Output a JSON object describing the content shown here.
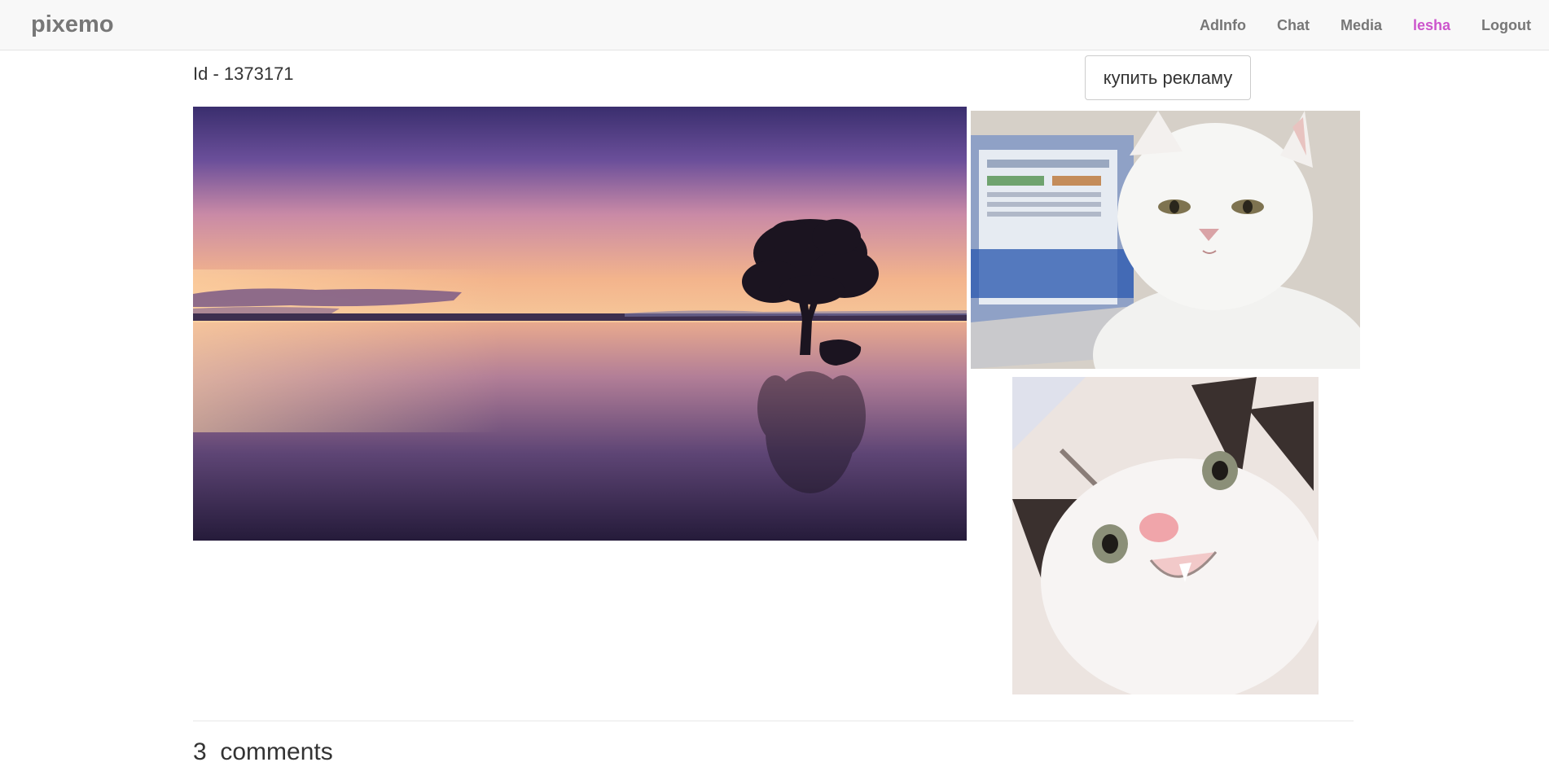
{
  "navbar": {
    "brand": "pixemo",
    "links": [
      "AdInfo",
      "Chat",
      "Media",
      "lesha",
      "Logout"
    ]
  },
  "post": {
    "id_label": "Id - 1373171",
    "buy_ad_label": "купить рекламу"
  },
  "comments": {
    "count": "3",
    "label": "comments"
  },
  "colors": {
    "navbar_bg": "#f8f8f8",
    "nav_link": "#777777",
    "active_user": "#cc55cc"
  },
  "images": {
    "main": "sunset-lake-tree-photo",
    "ad_1": "white-cat-laptop-photo",
    "ad_2": "smiling-cat-photo"
  }
}
